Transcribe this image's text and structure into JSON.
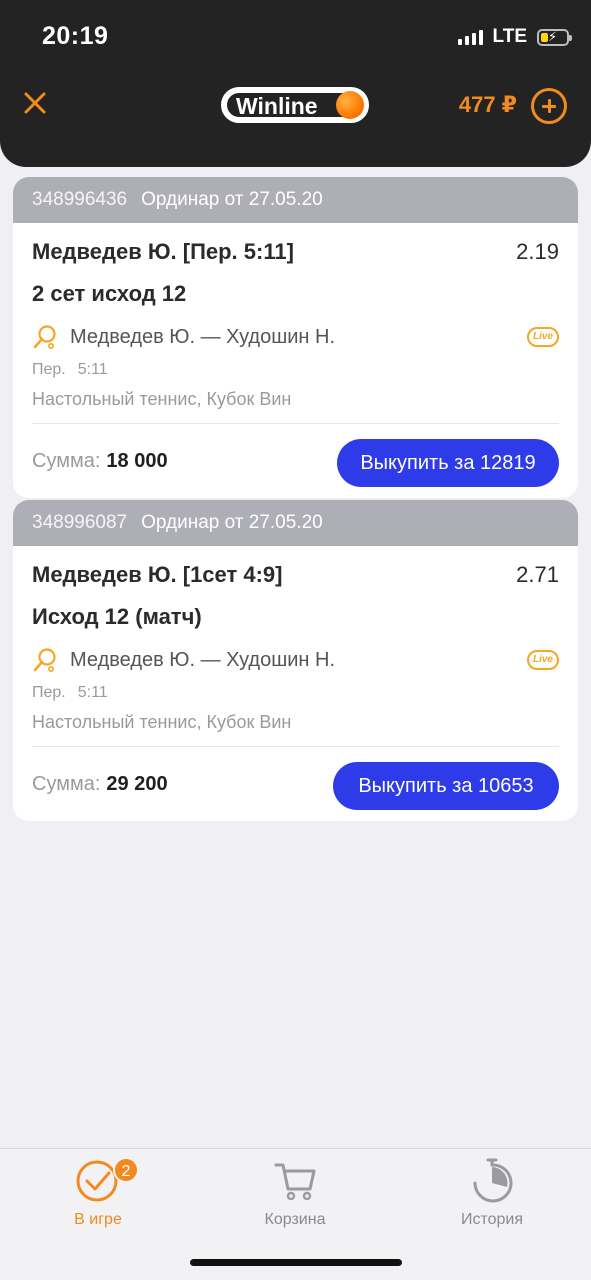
{
  "status_bar": {
    "time": "20:19",
    "network": "LTE"
  },
  "header": {
    "logo_text": "Winline",
    "balance": "477 ₽",
    "icons": {
      "close": "close-icon",
      "add": "plus-icon"
    },
    "accent_color": "#f28b1f"
  },
  "bets": [
    {
      "id": "348996436",
      "type": "Ординар от 27.05.20",
      "title": "Медведев Ю. [Пер. 5:11]",
      "odds": "2.19",
      "market": "2 сет исход 12",
      "event": "Медведев Ю. — Худошин Н.",
      "live": "Live",
      "period_label": "Пер.",
      "period_score": "5:11",
      "league": "Настольный теннис, Кубок Вин",
      "sum_label": "Сумма:",
      "sum_value": "18 000",
      "cashout_label": "Выкупить за 12819"
    },
    {
      "id": "348996087",
      "type": "Ординар от 27.05.20",
      "title": "Медведев Ю. [1сет 4:9]",
      "odds": "2.71",
      "market": "Исход 12 (матч)",
      "event": "Медведев Ю. — Худошин Н.",
      "live": "Live",
      "period_label": "Пер.",
      "period_score": "5:11",
      "league": "Настольный теннис, Кубок Вин",
      "sum_label": "Сумма:",
      "sum_value": "29 200",
      "cashout_label": "Выкупить за 10653"
    }
  ],
  "tabbar": {
    "tabs": [
      {
        "label": "В игре",
        "icon": "check-circle-icon",
        "badge": "2",
        "active": true
      },
      {
        "label": "Корзина",
        "icon": "cart-icon"
      },
      {
        "label": "История",
        "icon": "history-icon"
      }
    ]
  },
  "colors": {
    "cashout_button": "#2d3ce8",
    "header_bg": "#232323",
    "card_head": "#aeaeb6"
  }
}
